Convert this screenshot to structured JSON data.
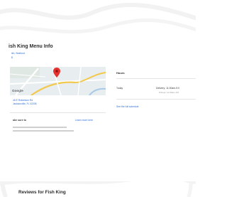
{
  "menu_info": {
    "title": "ish King Menu Info",
    "subtitle": "ish, Seafood",
    "price": "$",
    "address_line_1": "46 E Robertson Rd",
    "address_line_2": "Jacksonville, FL 32208"
  },
  "map": {
    "logo_text": "Google",
    "pin_color": "#e5322f"
  },
  "disclaimer": {
    "title": "ake sure to",
    "link_label": "Learn more here"
  },
  "hours": {
    "title": "Hours",
    "day": "Today",
    "delivery": "Delivery: 11:00am-9:0",
    "pickup": "Pickup: 11:00am-9:0",
    "link_label": "See the full schedule"
  },
  "reviews": {
    "title": "Reviews for Fish King"
  },
  "colors": {
    "link": "#2f6bd1",
    "text": "#2d2d2d"
  }
}
